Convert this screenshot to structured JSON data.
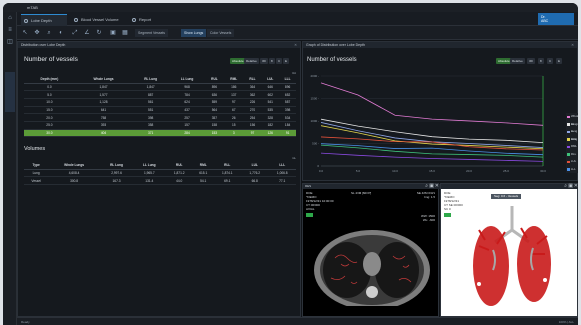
{
  "window": {
    "title": "mTAB"
  },
  "tabs": [
    {
      "label": "Lobe Depth",
      "active": true
    },
    {
      "label": "Blood Vessel Volume",
      "active": false
    },
    {
      "label": "Report",
      "active": false
    }
  ],
  "user": {
    "line1": "Dr.",
    "line2": "ABC"
  },
  "toolbar": {
    "text_buttons": [
      "Segment Vessels",
      "Show Lungs",
      "Color Vessels"
    ]
  },
  "left_panel": {
    "header": "Distribution over Lobe Depth",
    "section1_title": "Number of vessels",
    "toggle": {
      "absolute": "Absolute",
      "relative": "Relative"
    },
    "view_buttons": [
      "3D",
      "8",
      "C",
      "E"
    ],
    "table_note": "Vol",
    "columns": [
      "Depth (mm)",
      "Whole Lungs",
      "RL Lung",
      "LL Lung",
      "RUL",
      "RML",
      "RLL",
      "LUL",
      "LLL"
    ],
    "rows": [
      [
        "0.0",
        "1,847",
        "1,847",
        "968",
        "896",
        "186",
        "364",
        "646",
        "896"
      ],
      [
        "5.0",
        "1,577",
        "887",
        "784",
        "636",
        "137",
        "362",
        "602",
        "652"
      ],
      [
        "10.0",
        "1,128",
        "561",
        "624",
        "559",
        "97",
        "226",
        "541",
        "587"
      ],
      [
        "15.0",
        "641",
        "551",
        "437",
        "564",
        "67",
        "270",
        "535",
        "398"
      ],
      [
        "20.0",
        "758",
        "398",
        "257",
        "357",
        "26",
        "254",
        "328",
        "534"
      ],
      [
        "25.0",
        "393",
        "358",
        "157",
        "158",
        "15",
        "156",
        "182",
        "184"
      ],
      [
        "30.0",
        "404",
        "371",
        "284",
        "153",
        "3",
        "97",
        "126",
        "91"
      ]
    ],
    "section2_title": "Volumes",
    "section2_note": "mL",
    "vol_columns": [
      "Type",
      "Whole Lungs",
      "RL Lung",
      "LL Lung",
      "RUL",
      "RML",
      "RLL",
      "LUL",
      "LLL"
    ],
    "vol_rows": [
      [
        "Lung",
        "4,608.4",
        "2,997.6",
        "1,965.7",
        "1,871.2",
        "615.1",
        "1,874.1",
        "1,776.2",
        "1,006.8"
      ],
      [
        "Vessel",
        "300.8",
        "167.3",
        "131.4",
        "44.0",
        "54.1",
        "69.1",
        "66.8",
        "77.1"
      ]
    ]
  },
  "chart_panel": {
    "header": "Graph of Distribution over Lobe Depth",
    "title": "Number of vessels",
    "view_buttons": [
      "3D",
      "8",
      "C",
      "E"
    ],
    "chart_data": {
      "type": "line",
      "x": [
        0,
        5,
        10,
        15,
        20,
        25,
        30
      ],
      "ylim": [
        0,
        2000
      ],
      "yticks": [
        "0",
        "500 -",
        "1000 -",
        "1500 -",
        "2000 -"
      ],
      "xticks": [
        "0.0",
        "5.0",
        "10.0",
        "15.0",
        "20.0",
        "25.0",
        "30.0"
      ],
      "series": [
        {
          "name": "Whole Lungs",
          "color": "#e17bd3",
          "values": [
            1847,
            1577,
            1128,
            1041,
            1001,
            958,
            904
          ]
        },
        {
          "name": "RL Lung",
          "color": "#e6e6e6",
          "values": [
            1040,
            887,
            761,
            651,
            598,
            571,
            520
          ]
        },
        {
          "name": "LL Lung",
          "color": "#8fa6e6",
          "values": [
            968,
            784,
            624,
            537,
            500,
            457,
            410
          ]
        },
        {
          "name": "RUL",
          "color": "#e3d44c",
          "values": [
            896,
            736,
            559,
            488,
            457,
            420,
            383
          ]
        },
        {
          "name": "RML",
          "color": "#8a4ae0",
          "values": [
            286,
            237,
            197,
            167,
            146,
            125,
            103
          ]
        },
        {
          "name": "RLL",
          "color": "#3ec07a",
          "values": [
            464,
            402,
            326,
            270,
            254,
            236,
            197
          ]
        },
        {
          "name": "LUL",
          "color": "#e3513a",
          "values": [
            646,
            602,
            541,
            535,
            428,
            382,
            356
          ]
        },
        {
          "name": "LLL",
          "color": "#4a8fe6",
          "values": [
            496,
            452,
            387,
            398,
            334,
            284,
            251
          ]
        }
      ]
    }
  },
  "ct_view": {
    "label": "RES",
    "top_left": "DOE\n^DEMO\n1978/12/31 10:00:00\nCT 00/000\nAXIAL",
    "top_right": "SE 4/IM 0/3/1\nImg: 1.5",
    "bottom_right": "WW: 1500\nWL: -600",
    "center_top": "SL 4/IM [60/3?]"
  },
  "vessel_view": {
    "top_left": "DOE\n^DEMO\n1978/12/31\nCT SE 00/000\nSC 0",
    "tag": "Seg: 0.6 - Vessels"
  },
  "status": {
    "text": "Ready",
    "right": "100% | ALL"
  }
}
